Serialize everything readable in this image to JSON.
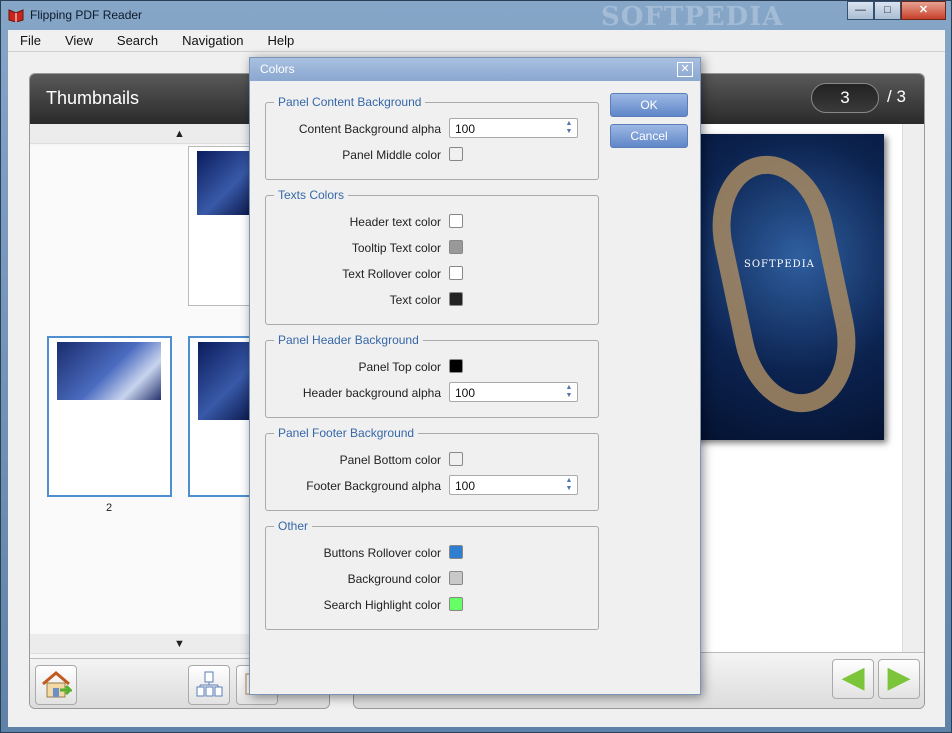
{
  "window": {
    "title": "Flipping PDF Reader",
    "watermark": "SOFTPEDIA",
    "controls": {
      "minimize": "—",
      "maximize": "□",
      "close": "✕"
    }
  },
  "menubar": {
    "items": [
      "File",
      "View",
      "Search",
      "Navigation",
      "Help"
    ]
  },
  "left_panel": {
    "title": "Thumbnails",
    "scroll_up": "▲",
    "scroll_down": "▼",
    "thumbnail_labels": [
      "2"
    ],
    "footer_icons": [
      "home-icon",
      "thumbnail-view-icon",
      "double-page-icon"
    ]
  },
  "viewer": {
    "current_page": "3",
    "total_pages": "/ 3",
    "page_brand": "SOFTPEDIA",
    "nav_prev": "◀",
    "nav_next": "▶"
  },
  "dialog": {
    "title": "Colors",
    "close": "✕",
    "ok_label": "OK",
    "cancel_label": "Cancel",
    "groups": [
      {
        "title": "Panel Content Background",
        "rows": [
          {
            "label": "Content Background alpha",
            "kind": "spinner",
            "value": "100"
          },
          {
            "label": "Panel Middle color",
            "kind": "swatch",
            "color": "#f0f0f0"
          }
        ]
      },
      {
        "title": "Texts Colors",
        "rows": [
          {
            "label": "Header text color",
            "kind": "swatch",
            "color": "#ffffff"
          },
          {
            "label": "Tooltip Text color",
            "kind": "swatch",
            "color": "#999999"
          },
          {
            "label": "Text Rollover color",
            "kind": "swatch",
            "color": "#ffffff"
          },
          {
            "label": "Text color",
            "kind": "swatch",
            "color": "#222222"
          }
        ]
      },
      {
        "title": "Panel Header Background",
        "rows": [
          {
            "label": "Panel Top color",
            "kind": "swatch",
            "color": "#000000"
          },
          {
            "label": "Header background alpha",
            "kind": "spinner",
            "value": "100"
          }
        ]
      },
      {
        "title": "Panel Footer Background",
        "rows": [
          {
            "label": "Panel Bottom color",
            "kind": "swatch",
            "color": "#f0f0f0"
          },
          {
            "label": "Footer Background alpha",
            "kind": "spinner",
            "value": "100"
          }
        ]
      },
      {
        "title": "Other",
        "rows": [
          {
            "label": "Buttons Rollover color",
            "kind": "swatch",
            "color": "#2e7fd1"
          },
          {
            "label": "Background color",
            "kind": "swatch",
            "color": "#c8c8c8"
          },
          {
            "label": "Search Highlight color",
            "kind": "swatch",
            "color": "#66ff66"
          }
        ]
      }
    ]
  }
}
